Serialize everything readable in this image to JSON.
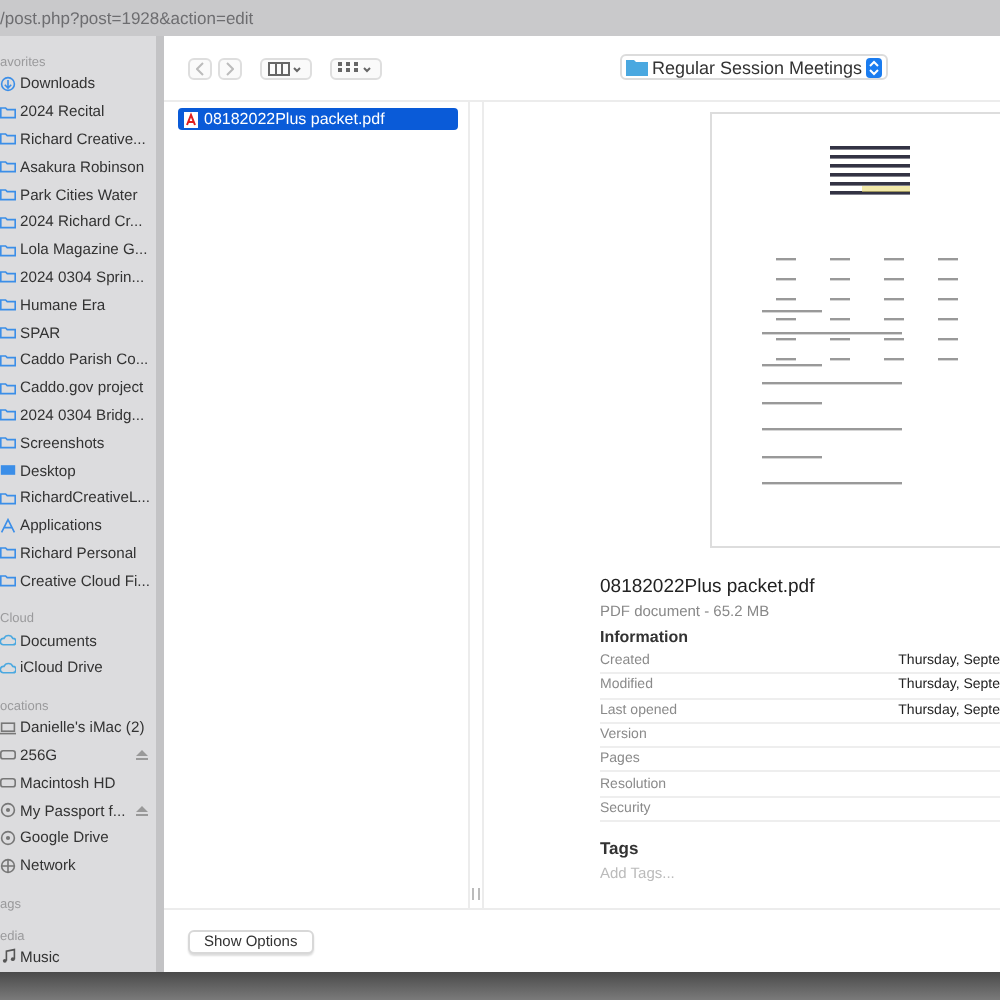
{
  "address_bar": {
    "url": "/post.php?post=1928&action=edit"
  },
  "sidebar": {
    "sections": [
      {
        "title": "avorites",
        "items": [
          {
            "label": "Downloads",
            "kind": "download"
          },
          {
            "label": "2024 Recital",
            "kind": "folder"
          },
          {
            "label": "Richard Creative...",
            "kind": "folder"
          },
          {
            "label": "Asakura Robinson",
            "kind": "folder"
          },
          {
            "label": "Park Cities Water",
            "kind": "folder"
          },
          {
            "label": "2024 Richard Cr...",
            "kind": "folder"
          },
          {
            "label": "Lola Magazine G...",
            "kind": "folder"
          },
          {
            "label": "2024 0304 Sprin...",
            "kind": "folder"
          },
          {
            "label": "Humane Era",
            "kind": "folder"
          },
          {
            "label": "SPAR",
            "kind": "folder"
          },
          {
            "label": "Caddo Parish Co...",
            "kind": "folder"
          },
          {
            "label": "Caddo.gov project",
            "kind": "folder"
          },
          {
            "label": "2024 0304 Bridg...",
            "kind": "folder"
          },
          {
            "label": "Screenshots",
            "kind": "folder"
          },
          {
            "label": "Desktop",
            "kind": "desktop"
          },
          {
            "label": "RichardCreativeL...",
            "kind": "folder"
          },
          {
            "label": "Applications",
            "kind": "apps"
          },
          {
            "label": "Richard Personal",
            "kind": "folder"
          },
          {
            "label": "Creative Cloud Fi...",
            "kind": "folder"
          }
        ]
      },
      {
        "title": "Cloud",
        "items": [
          {
            "label": "Documents",
            "kind": "cloud"
          },
          {
            "label": "iCloud Drive",
            "kind": "cloud"
          }
        ]
      },
      {
        "title": "ocations",
        "items": [
          {
            "label": "Danielle's iMac (2)",
            "kind": "computer"
          },
          {
            "label": "256G",
            "kind": "disk",
            "ejectable": true
          },
          {
            "label": "Macintosh HD",
            "kind": "disk"
          },
          {
            "label": "My Passport f...",
            "kind": "drive",
            "ejectable": true
          },
          {
            "label": "Google Drive",
            "kind": "drive"
          },
          {
            "label": "Network",
            "kind": "network"
          }
        ]
      },
      {
        "title": "ags"
      },
      {
        "title": "edia",
        "items": [
          {
            "label": "Music",
            "kind": "music"
          }
        ]
      }
    ]
  },
  "location": {
    "label": "Regular Session Meetings"
  },
  "files": [
    {
      "name": "08182022Plus packet.pdf",
      "selected": true
    }
  ],
  "preview": {
    "name": "08182022Plus packet.pdf",
    "subtitle": "PDF document - 65.2 MB",
    "info_title": "Information",
    "info": [
      {
        "label": "Created",
        "value": "Thursday, Septe"
      },
      {
        "label": "Modified",
        "value": "Thursday, Septe"
      },
      {
        "label": "Last opened",
        "value": "Thursday, Septe"
      },
      {
        "label": "Version"
      },
      {
        "label": "Pages"
      },
      {
        "label": "Resolution"
      },
      {
        "label": "Security"
      }
    ],
    "tags_title": "Tags",
    "tags_placeholder": "Add Tags..."
  },
  "footer": {
    "button": "Show Options"
  }
}
